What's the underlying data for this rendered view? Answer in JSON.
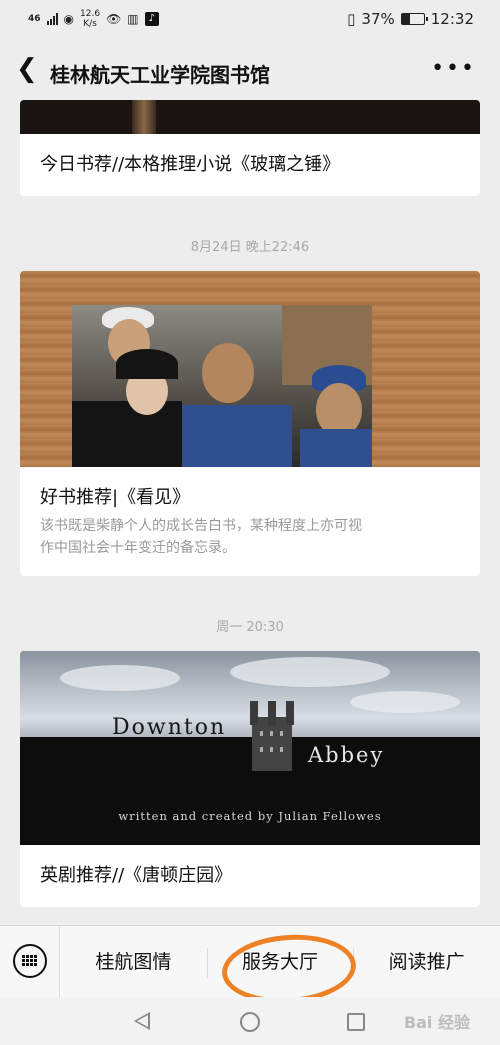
{
  "status_bar": {
    "network": "46",
    "speed_value": "12.6",
    "speed_unit": "K/s",
    "battery_text": "37%",
    "battery_level": 0.37,
    "time": "12:32"
  },
  "header": {
    "title": "桂林航天工业学院图书馆"
  },
  "feed": {
    "article1": {
      "title": "今日书荐//本格推理小说《玻璃之锤》"
    },
    "ts2": "8月24日 晚上22:46",
    "article2": {
      "title": "好书推荐|《看见》",
      "desc_line1": "该书既是柴静个人的成长告白书，某种程度上亦可视",
      "desc_line2": "作中国社会十年变迁的备忘录。"
    },
    "ts3": "周一 20:30",
    "article3": {
      "img_word1": "Downton",
      "img_word2": "Abbey",
      "img_credit": "written and created by Julian Fellowes",
      "title": "英剧推荐//《唐顿庄园》"
    }
  },
  "bottom_menu": {
    "item1": "桂航图情",
    "item2": "服务大厅",
    "item3": "阅读推广",
    "highlight_color": "#ee8126"
  },
  "watermark": "Bai 经验"
}
